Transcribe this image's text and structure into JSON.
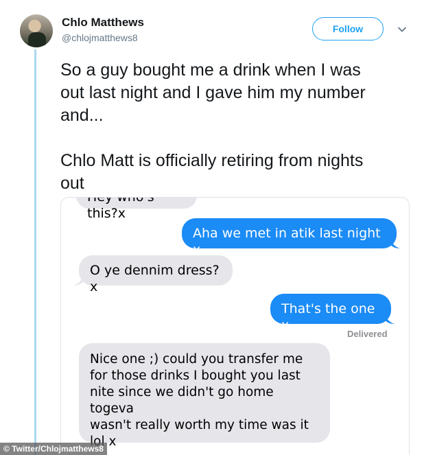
{
  "user": {
    "name": "Chlo Matthews",
    "handle": "@chlojmatthews8"
  },
  "header": {
    "follow_label": "Follow",
    "menu_icon": "chevron-down-icon"
  },
  "tweet": {
    "line1": "So a guy bought me a drink when I was",
    "line2": "out last night and I gave him my number",
    "line3": "and...",
    "line4": "Chlo Matt is officially retiring from nights",
    "line5": "out"
  },
  "conversation": {
    "messages": [
      {
        "side": "received",
        "text": "Hey who's this?x"
      },
      {
        "side": "sent",
        "text": "Aha we met in atik last night x"
      },
      {
        "side": "received",
        "text": "O ye dennim dress?x"
      },
      {
        "side": "sent",
        "text": "That's the one x"
      },
      {
        "side": "received",
        "lines": [
          "Nice one ;) could you transfer me",
          "for those drinks I bought you last",
          "nite since we didn't go home togeva",
          "wasn't really worth my time was it",
          "lol x"
        ]
      }
    ],
    "status": "Delivered"
  },
  "watermark": "© Twitter/Chlojmatthews8",
  "colors": {
    "accent": "#1da1f2",
    "sent_bubble": "#1b8bf5",
    "received_bubble": "#e5e5ea",
    "thread_line": "#aad8f0"
  }
}
